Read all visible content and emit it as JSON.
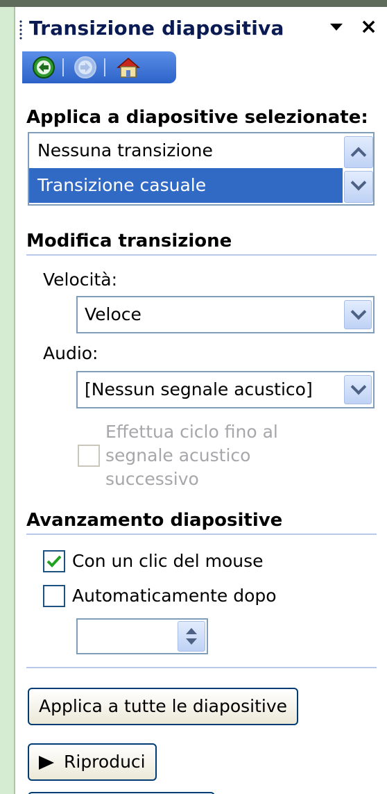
{
  "panel": {
    "title": "Transizione diapositiva"
  },
  "nav": {
    "back": "back-icon",
    "forward": "forward-icon",
    "home": "home-icon"
  },
  "apply_section": {
    "title": "Applica a diapositive selezionate:",
    "items": [
      {
        "label": "Nessuna transizione",
        "selected": false
      },
      {
        "label": "Transizione casuale",
        "selected": true
      }
    ]
  },
  "modify_section": {
    "title": "Modifica transizione",
    "speed_label": "Velocità:",
    "speed_value": "Veloce",
    "audio_label": "Audio:",
    "audio_value": "[Nessun segnale acustico]",
    "loop_line1": "Effettua ciclo fino al",
    "loop_line2": "segnale acustico",
    "loop_line3": "successivo",
    "loop_checked": false,
    "loop_disabled": true
  },
  "advance_section": {
    "title": "Avanzamento diapositive",
    "on_click_label": "Con un clic del mouse",
    "on_click_checked": true,
    "auto_label": "Automaticamente dopo",
    "auto_checked": false,
    "auto_value": ""
  },
  "buttons": {
    "apply_all": "Applica a tutte le diapositive",
    "play": "Riproduci"
  },
  "colors": {
    "accent": "#316ac5",
    "nav_bar": "#2d63c8",
    "title_text": "#0a1a52",
    "disabled_text": "#a7a6aa",
    "check_green": "#21a121"
  }
}
